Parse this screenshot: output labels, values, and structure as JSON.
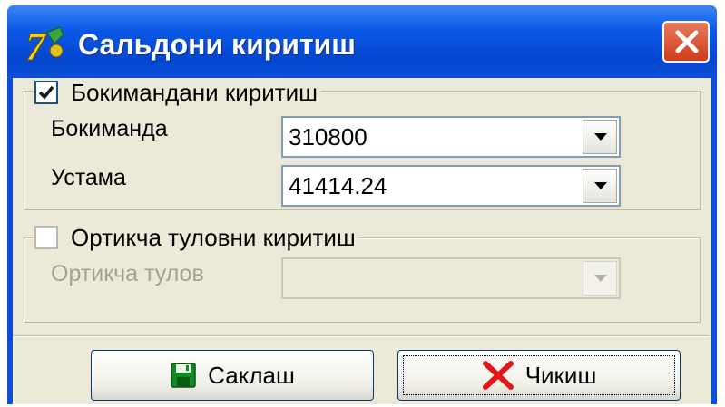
{
  "window": {
    "title": "Сальдони киритиш",
    "app_icon": "app-logo-icon",
    "close_icon": "close-icon"
  },
  "group_account": {
    "checkbox_label": "Бокимандани киритиш",
    "checked": true,
    "account_label": "Бокиманда",
    "account_value": "310800",
    "balance_label": "Устама",
    "balance_value": "41414.24"
  },
  "group_middle_value": {
    "checkbox_label": "Ортикча туловни киритиш",
    "checked": false,
    "field_label": "Ортикча тулов",
    "field_value": ""
  },
  "buttons": {
    "save_label": "Саклаш",
    "save_icon": "save-floppy-icon",
    "exit_label": "Чикиш",
    "exit_icon": "close-x-icon"
  },
  "colors": {
    "title_bar": "#0a4fd6",
    "dialog_bg": "#ece9d8",
    "close_button": "#d9491f"
  }
}
